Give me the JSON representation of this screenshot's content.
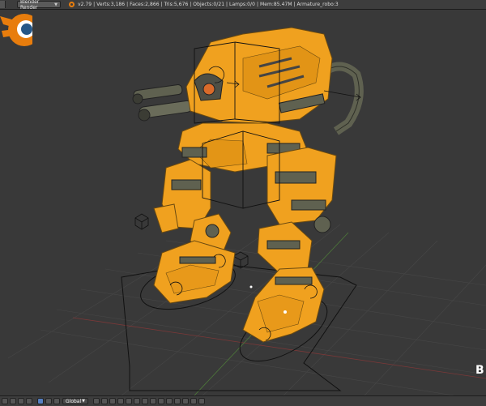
{
  "header": {
    "render_engine": "Blender Render",
    "stats": "v2.79 | Verts:3,186 | Faces:2,866 | Tris:5,676 | Objects:0/21 | Lamps:0/0 | Mem:85.47M | Armature_robo:3"
  },
  "viewport": {
    "object": "mech robot with armature",
    "logo_letter": "B"
  },
  "footer": {
    "orientation": "Global"
  },
  "colors": {
    "robot_orange": "#f0a11f",
    "robot_dark": "#5f6150",
    "viewport_bg": "#393939",
    "grid": "#474747",
    "blender_orange": "#e87d0d",
    "blender_blue": "#265787"
  }
}
